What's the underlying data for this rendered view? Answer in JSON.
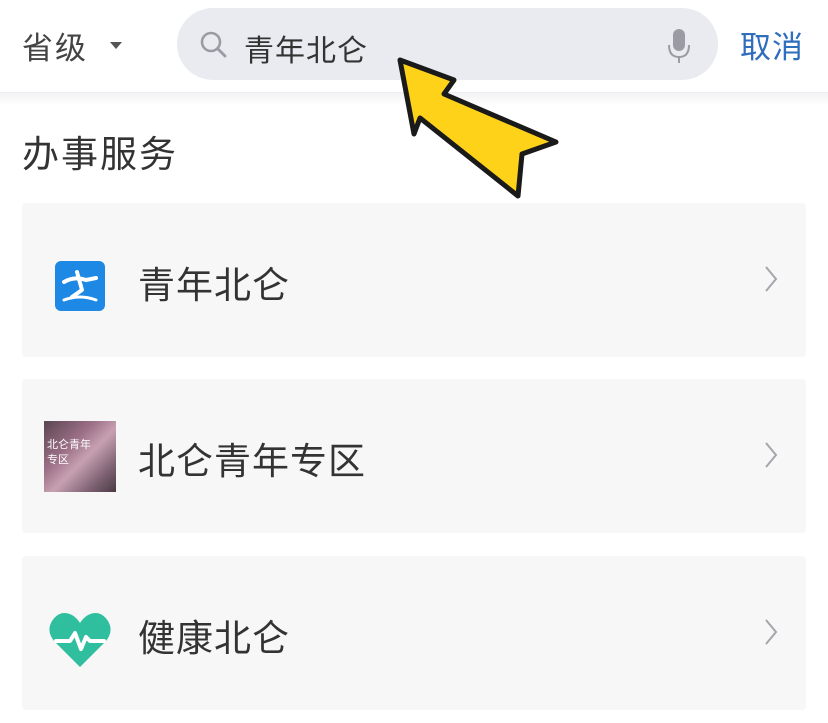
{
  "header": {
    "region_label": "省级",
    "search_value": "青年北仑",
    "cancel_label": "取消"
  },
  "section": {
    "title": "办事服务"
  },
  "services": [
    {
      "label": "青年北仑",
      "icon": "youth-beilun-app-icon"
    },
    {
      "label": "北仑青年专区",
      "icon": "youth-zone-thumbnail",
      "thumbnail_text": "北仑青年专区"
    },
    {
      "label": "健康北仑",
      "icon": "health-heart-icon"
    }
  ],
  "colors": {
    "accent": "#2f6dbd",
    "search_bg": "#e9ebf0",
    "card_bg": "#f7f7f8",
    "health_icon": "#2fbf9f",
    "youth_icon": "#1e88e5",
    "pointer_arrow": "#ffd21a"
  }
}
